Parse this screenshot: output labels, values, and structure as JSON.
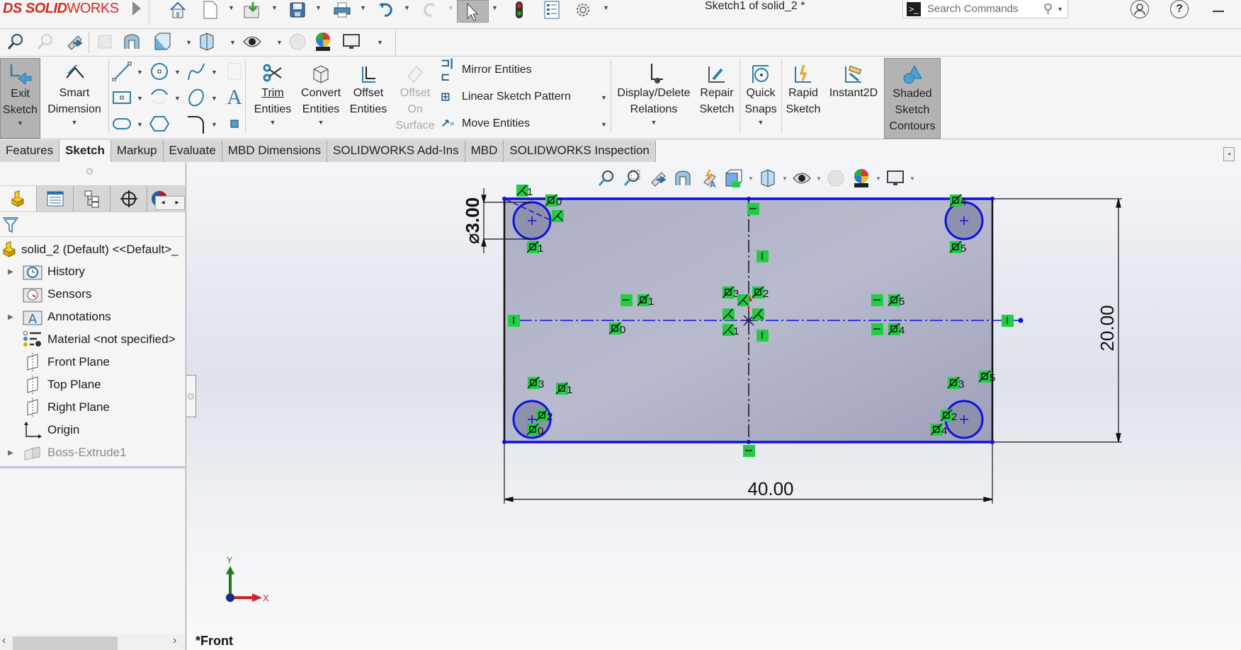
{
  "app": {
    "brand_prefix": "DS",
    "brand_bold": "SOLID",
    "brand_light": "WORKS",
    "document_title": "Sketch1 of solid_2 *"
  },
  "search": {
    "placeholder": "Search Commands"
  },
  "title_icons": [
    "home-icon",
    "new-document-icon",
    "open-icon",
    "save-icon",
    "print-icon",
    "undo-icon",
    "redo-icon",
    "select-icon",
    "rebuild-icon",
    "file-properties-icon",
    "options-icon",
    "account-icon",
    "help-icon",
    "minimize-icon"
  ],
  "command_manager": {
    "exit_sketch": {
      "line1": "Exit",
      "line2": "Sketch"
    },
    "smart_dimension": {
      "line1": "Smart",
      "line2": "Dimension"
    },
    "trim": {
      "line1": "Trim",
      "line2": "Entities"
    },
    "convert": {
      "line1": "Convert",
      "line2": "Entities"
    },
    "offset": {
      "line1": "Offset",
      "line2": "Entities"
    },
    "offset_surface": {
      "line1": "Offset",
      "line2": "On",
      "line3": "Surface"
    },
    "mirror": "Mirror Entities",
    "linear_pattern": "Linear Sketch Pattern",
    "move": "Move Entities",
    "display_delete": {
      "line1": "Display/Delete",
      "line2": "Relations"
    },
    "repair": {
      "line1": "Repair",
      "line2": "Sketch"
    },
    "quick_snaps": {
      "line1": "Quick",
      "line2": "Snaps"
    },
    "rapid_sketch": {
      "line1": "Rapid",
      "line2": "Sketch"
    },
    "instant2d": {
      "line1": "Instant2D"
    },
    "shaded_contours": {
      "line1": "Shaded",
      "line2": "Sketch",
      "line3": "Contours",
      "active": true
    }
  },
  "tabs": [
    {
      "label": "Features",
      "active": false
    },
    {
      "label": "Sketch",
      "active": true
    },
    {
      "label": "Markup",
      "active": false
    },
    {
      "label": "Evaluate",
      "active": false
    },
    {
      "label": "MBD Dimensions",
      "active": false
    },
    {
      "label": "SOLIDWORKS Add-Ins",
      "active": false
    },
    {
      "label": "MBD",
      "active": false
    },
    {
      "label": "SOLIDWORKS Inspection",
      "active": false
    }
  ],
  "feature_tree": {
    "root": "solid_2 (Default) <<Default>_",
    "items": [
      {
        "label": "History",
        "icon": "history-folder-icon",
        "expandable": true
      },
      {
        "label": "Sensors",
        "icon": "sensors-folder-icon",
        "expandable": false
      },
      {
        "label": "Annotations",
        "icon": "annotations-folder-icon",
        "expandable": true
      },
      {
        "label": "Material <not specified>",
        "icon": "material-icon",
        "expandable": false
      },
      {
        "label": "Front Plane",
        "icon": "plane-icon",
        "expandable": false
      },
      {
        "label": "Top Plane",
        "icon": "plane-icon",
        "expandable": false
      },
      {
        "label": "Right Plane",
        "icon": "plane-icon",
        "expandable": false
      },
      {
        "label": "Origin",
        "icon": "origin-icon",
        "expandable": false
      },
      {
        "label": "Boss-Extrude1",
        "icon": "extrude-icon",
        "expandable": true,
        "dimmed": true
      }
    ]
  },
  "sketch": {
    "dimensions": {
      "width": "40.00",
      "height": "20.00",
      "diameter": "⌀3.00"
    },
    "relation_labels": {
      "top_left": [
        "1",
        "0",
        "1"
      ],
      "center_left": [
        "1",
        "0"
      ],
      "center": [
        "3",
        "2",
        "1"
      ],
      "center_right": [
        "5",
        "4"
      ],
      "top_right": [
        "4",
        "5"
      ],
      "bottom_left": [
        "3",
        "1",
        "2",
        "0"
      ],
      "bottom_right": [
        "3",
        "5",
        "2",
        "4"
      ]
    },
    "colors": {
      "sketch_line": "#1010e0",
      "relation": "#22cc44",
      "fill": "#a8abc2",
      "dimension": "#000000"
    }
  },
  "triad": {
    "x": "X",
    "y": "Y"
  },
  "view_label": "*Front"
}
